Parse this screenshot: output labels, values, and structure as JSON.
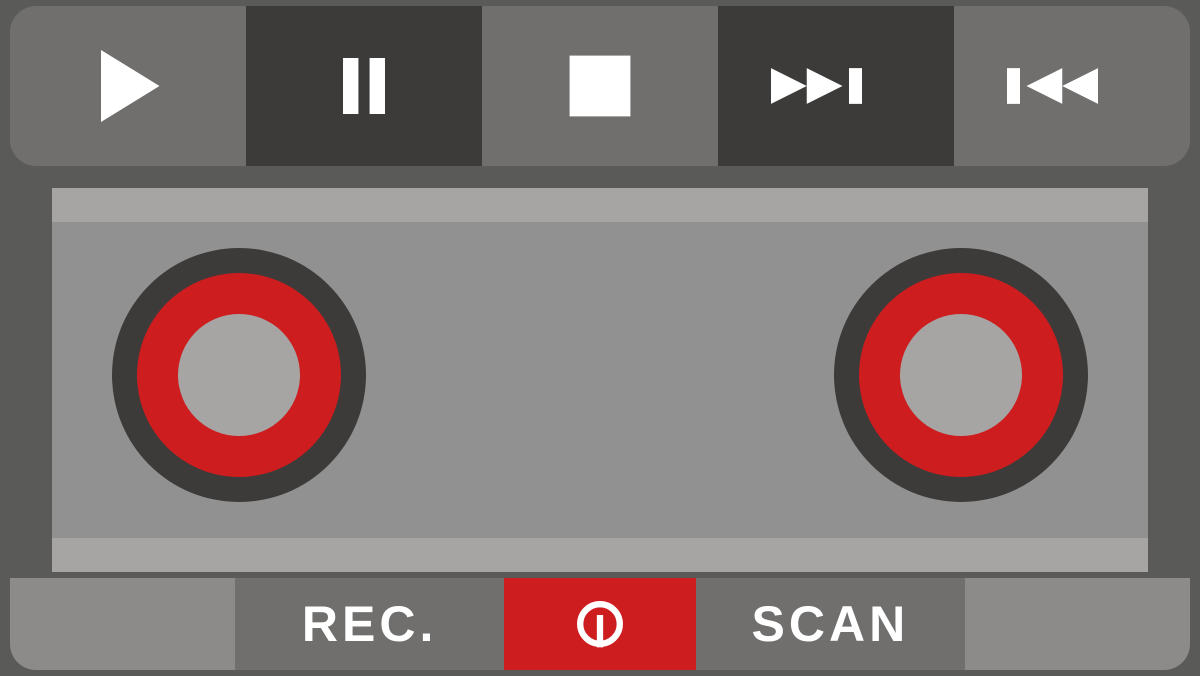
{
  "transport": {
    "buttons": [
      {
        "name": "play-button",
        "icon": "play-icon"
      },
      {
        "name": "pause-button",
        "icon": "pause-icon"
      },
      {
        "name": "stop-button",
        "icon": "stop-icon"
      },
      {
        "name": "next-button",
        "icon": "next-track-icon"
      },
      {
        "name": "prev-button",
        "icon": "prev-track-icon"
      }
    ]
  },
  "deck": {
    "reels": [
      "left-reel",
      "right-reel"
    ]
  },
  "bottom": {
    "rec_label": "REC.",
    "scan_label": "SCAN",
    "power_icon": "power-icon"
  },
  "colors": {
    "accent_red": "#cd1d1f",
    "dark": "#3c3b3a",
    "mid": "#706f6e",
    "light": "#929191",
    "rail": "#a6a5a4",
    "white": "#ffffff"
  }
}
